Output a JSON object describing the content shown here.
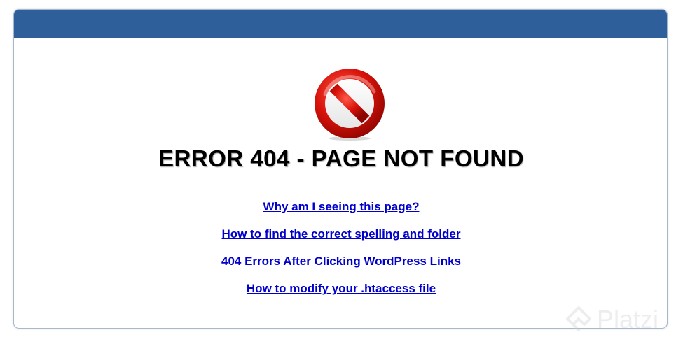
{
  "page": {
    "title": "ERROR 404 - PAGE NOT FOUND",
    "header_color": "#2e5f9b",
    "link_color": "#0000cc"
  },
  "links": [
    {
      "label": "Why am I seeing this page?"
    },
    {
      "label": "How to find the correct spelling and folder"
    },
    {
      "label": "404 Errors After Clicking WordPress Links"
    },
    {
      "label": "How to modify your .htaccess file"
    }
  ],
  "icons": {
    "error": "stop-sign-icon",
    "watermark": "platzi-logo"
  },
  "watermark": {
    "text": "Platzi"
  }
}
